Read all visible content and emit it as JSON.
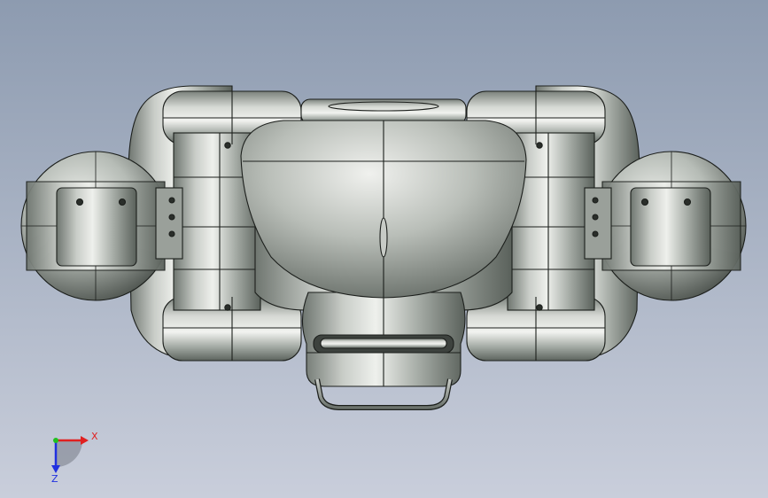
{
  "viewport": {
    "background_top": "#8d9bb0",
    "background_bottom": "#c9cedb"
  },
  "model": {
    "body_light": "#d9dcd8",
    "body_mid": "#aab0aa",
    "body_dark": "#5e655f",
    "edge_color": "#1c1f1c"
  },
  "triad": {
    "x_label": "X",
    "z_label": "Z",
    "x_color": "#e02020",
    "y_color": "#20c020",
    "z_color": "#2030e0"
  }
}
